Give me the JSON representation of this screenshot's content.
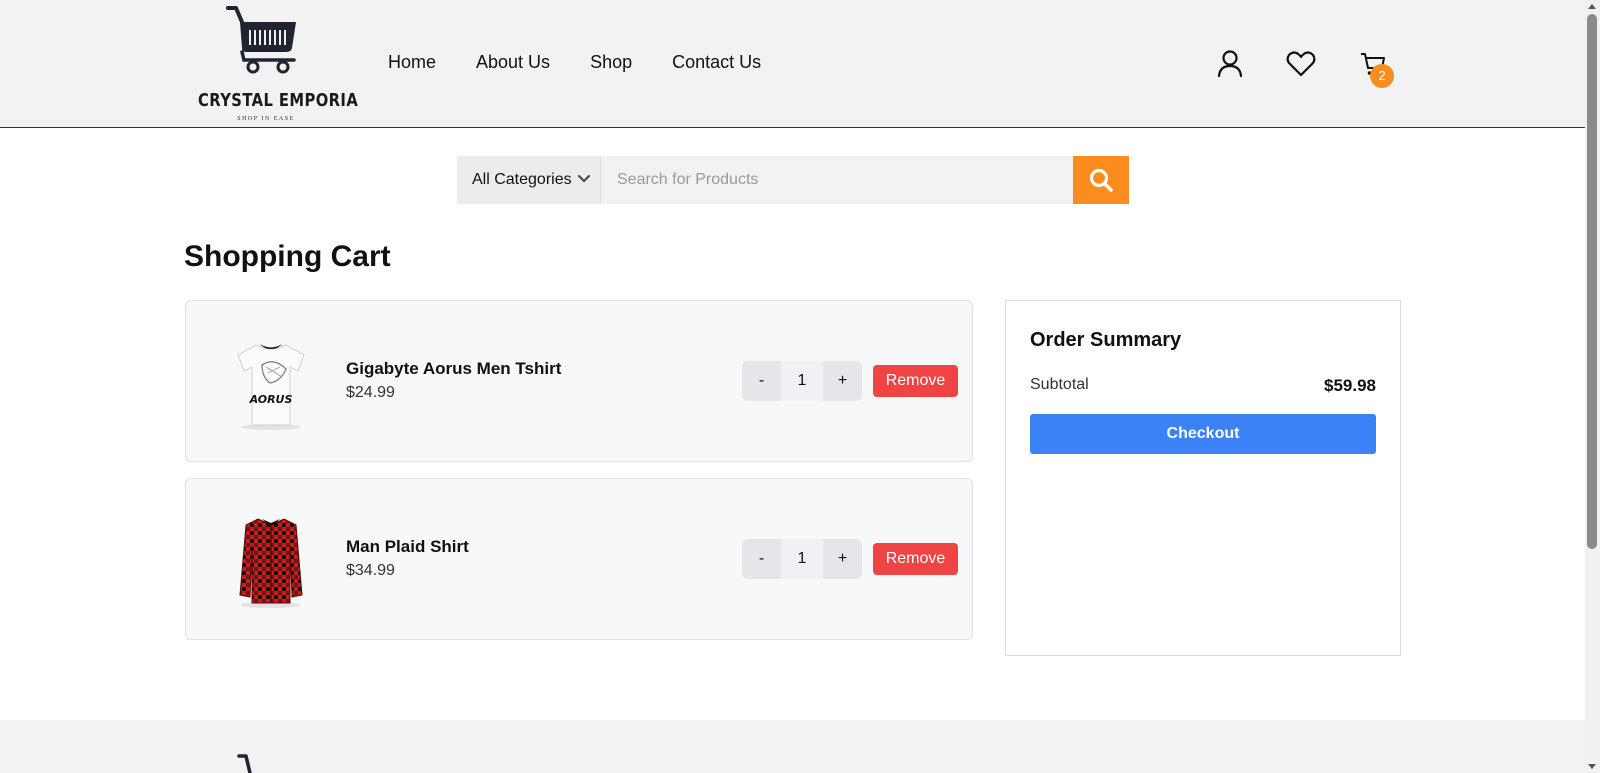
{
  "header": {
    "logo": {
      "name": "CRYSTAL EMPORIA",
      "tagline": "SHOP IN EASE"
    },
    "nav": [
      {
        "label": "Home"
      },
      {
        "label": "About Us"
      },
      {
        "label": "Shop"
      },
      {
        "label": "Contact Us"
      }
    ],
    "icons": [
      "user-icon",
      "heart-icon",
      "cart-icon"
    ],
    "cart_count": "2"
  },
  "search": {
    "category": "All Categories",
    "placeholder": "Search for Products",
    "button_icon": "search-icon"
  },
  "page_title": "Shopping Cart",
  "cart": {
    "items": [
      {
        "name": "Gigabyte Aorus Men Tshirt",
        "price": "$24.99",
        "quantity": "1",
        "decrement": "-",
        "increment": "+",
        "remove": "Remove",
        "image": "white-tshirt-image"
      },
      {
        "name": "Man Plaid Shirt",
        "price": "$34.99",
        "quantity": "1",
        "decrement": "-",
        "increment": "+",
        "remove": "Remove",
        "image": "red-plaid-shirt-image"
      }
    ]
  },
  "summary": {
    "title": "Order Summary",
    "subtotal_label": "Subtotal",
    "subtotal_value": "$59.98",
    "checkout_label": "Checkout"
  },
  "colors": {
    "accent_orange": "#fb8c1e",
    "checkout_blue": "#3b82f6",
    "remove_red": "#ef4444",
    "header_bg": "#f2f2f2"
  }
}
